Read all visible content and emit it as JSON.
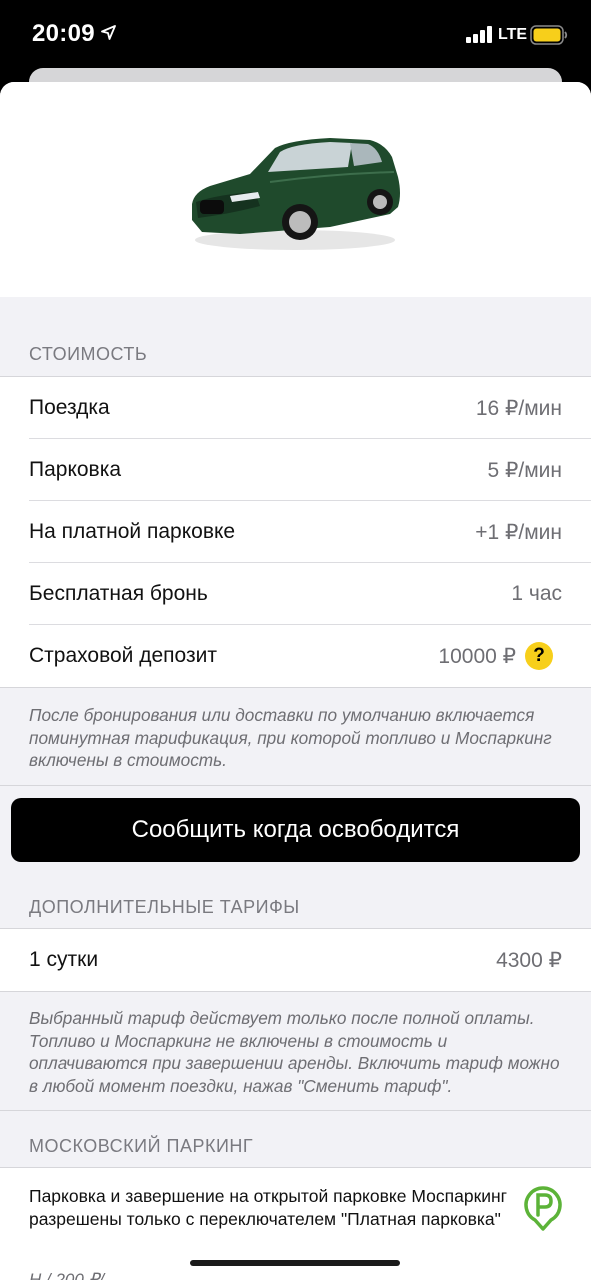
{
  "status_bar": {
    "time": "20:09",
    "network": "LTE"
  },
  "pricing": {
    "header": "СТОИМОСТЬ",
    "rows": [
      {
        "label": "Поездка",
        "value": "16 ₽/мин"
      },
      {
        "label": "Парковка",
        "value": "5 ₽/мин"
      },
      {
        "label": "На платной парковке",
        "value": "+1 ₽/мин"
      },
      {
        "label": "Бесплатная бронь",
        "value": "1 час"
      },
      {
        "label": "Страховой депозит",
        "value": "10000 ₽"
      }
    ],
    "help_label": "?",
    "note": "После бронирования или доставки по умолчанию включается поминутная тарификация, при которой топливо и Моспаркинг включены в стоимость."
  },
  "notify_button": "Сообщить когда освободится",
  "extra_tariffs": {
    "header": "ДОПОЛНИТЕЛЬНЫЕ ТАРИФЫ",
    "rows": [
      {
        "label": "1 сутки",
        "value": "4300 ₽"
      }
    ],
    "note": "Выбранный тариф действует только после полной оплаты. Топливо и Моспаркинг не включены в стоимость и оплачиваются при завершении аренды. Включить тариф можно в любой момент поездки, нажав \"Сменить тариф\"."
  },
  "moscow_parking": {
    "header": "МОСКОВСКИЙ ПАРКИНГ",
    "text": "Парковка и завершение на открытой парковке Моспаркинг разрешены только с переключателем \"Платная парковка\"",
    "cut_text": "Н                              / 200 ₽/"
  },
  "colors": {
    "accent_yellow": "#f7cf1b",
    "parking_green": "#5cb338",
    "button_bg": "#000000"
  },
  "icons": [
    "location-arrow-icon",
    "signal-icon",
    "battery-icon",
    "help-icon",
    "parking-pin-icon"
  ]
}
